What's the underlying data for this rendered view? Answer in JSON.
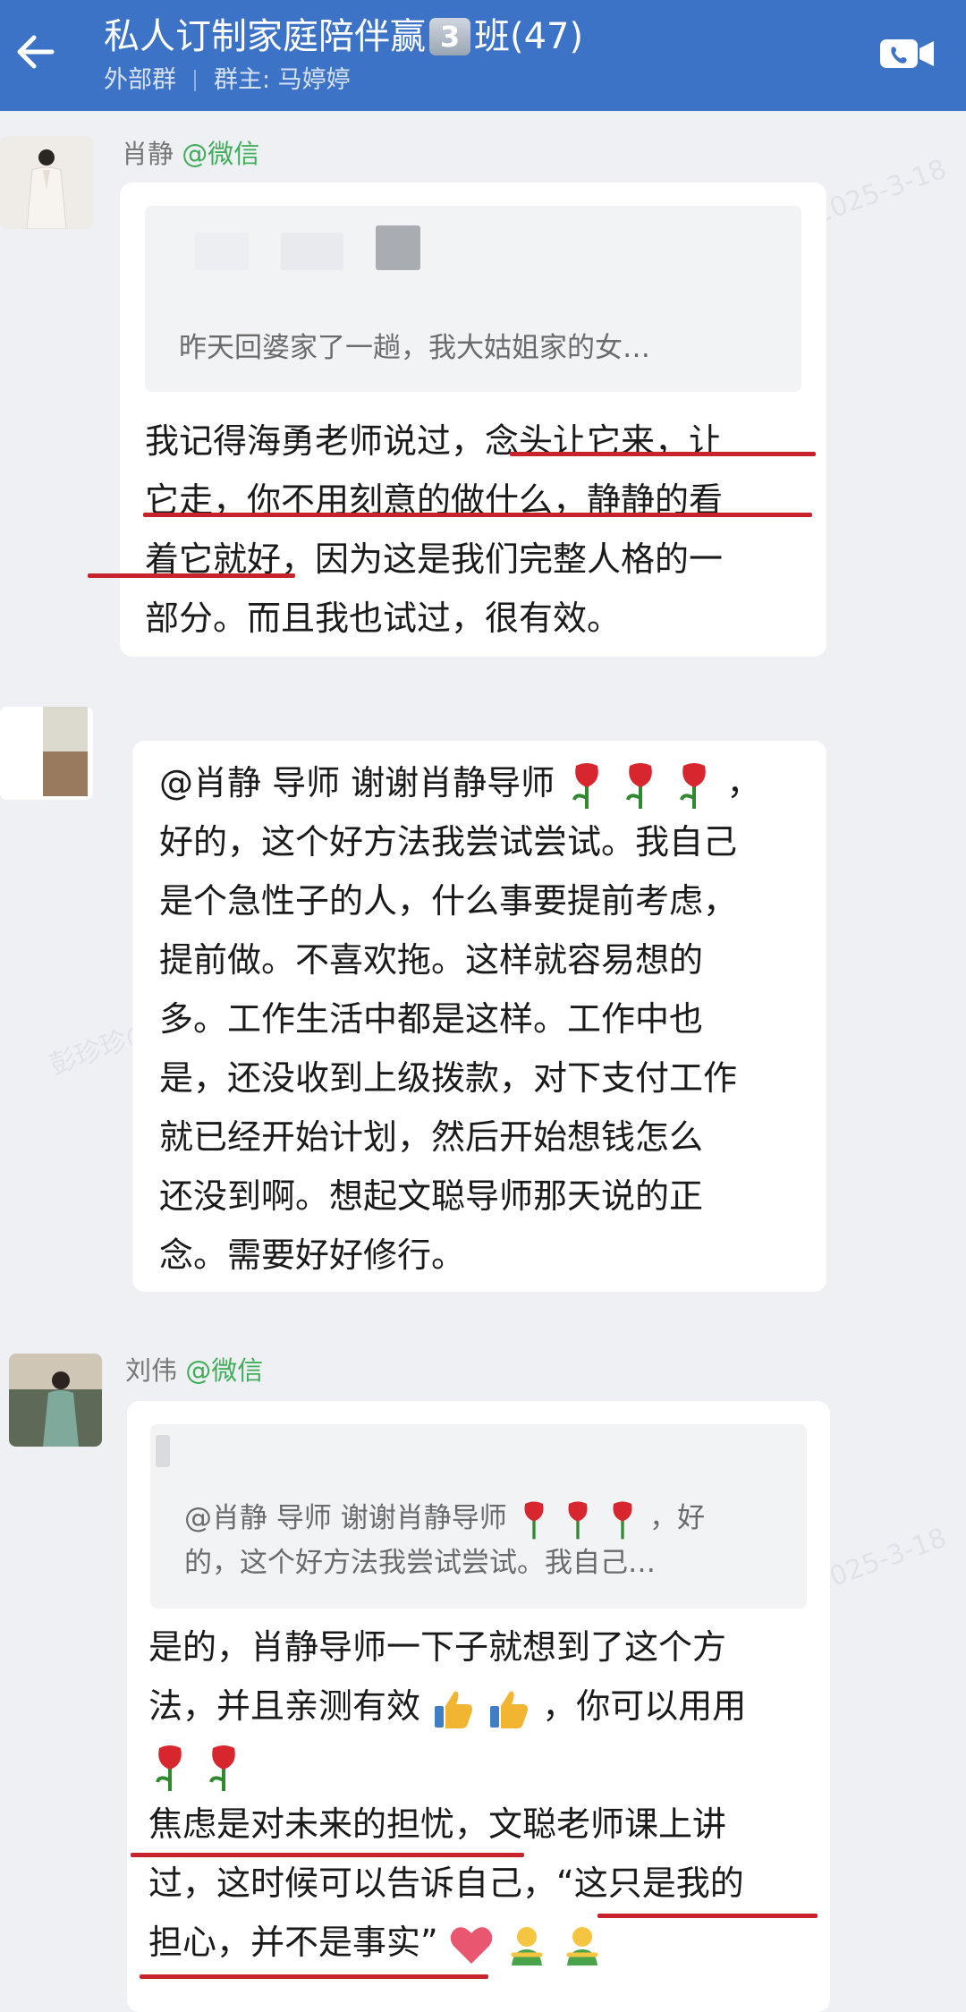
{
  "header": {
    "title_prefix": "私人订制家庭陪伴赢",
    "title_badge": "3",
    "title_suffix": "班(47)",
    "group_type": "外部群",
    "owner": "群主: 马婷婷",
    "colors": {
      "bar": "#3d73c7",
      "text": "#ffffff"
    },
    "icons": [
      "arrow-left-icon",
      "video-call-icon"
    ]
  },
  "messages": [
    {
      "sender_name": "肖静",
      "sender_tag": "@微信",
      "quote_text": "昨天回婆家了一趟，我大姑姐家的女…",
      "lines": [
        "我记得海勇老师说过，念头让它来，让",
        "它走，你不用刻意的做什么，静静的看",
        "着它就好，因为这是我们完整人格的一",
        "部分。而且我也试过，很有效。"
      ]
    },
    {
      "lines": [
        "@肖静 导师 谢谢肖静导师",
        "好的，这个好方法我尝试尝试。我自己",
        "是个急性子的人，什么事要提前考虑，",
        "提前做。不喜欢拖。这样就容易想的",
        "多。工作生活中都是这样。工作中也",
        "是，还没收到上级拨款，对下支付工作",
        "就已经开始计划，然后开始想钱怎么",
        "还没到啊。想起文聪导师那天说的正",
        "念。需要好好修行。"
      ],
      "line1_tail": "，"
    },
    {
      "sender_name": "刘伟",
      "sender_tag": "@微信",
      "quote_line1": "@肖静 导师 谢谢肖静导师",
      "quote_line1_tail": "，好",
      "quote_line2": "的，这个好方法我尝试尝试。我自己…",
      "lines": [
        "是的，肖静导师一下子就想到了这个方",
        "法，并且亲测有效",
        "，你可以用用",
        "焦虑是对未来的担忧，文聪老师课上讲",
        "过，这时候可以告诉自己，“这只是我的",
        "担心，并不是事实”"
      ]
    }
  ],
  "watermark": "彭珍珍@心时代父母5987 2025-3-18"
}
